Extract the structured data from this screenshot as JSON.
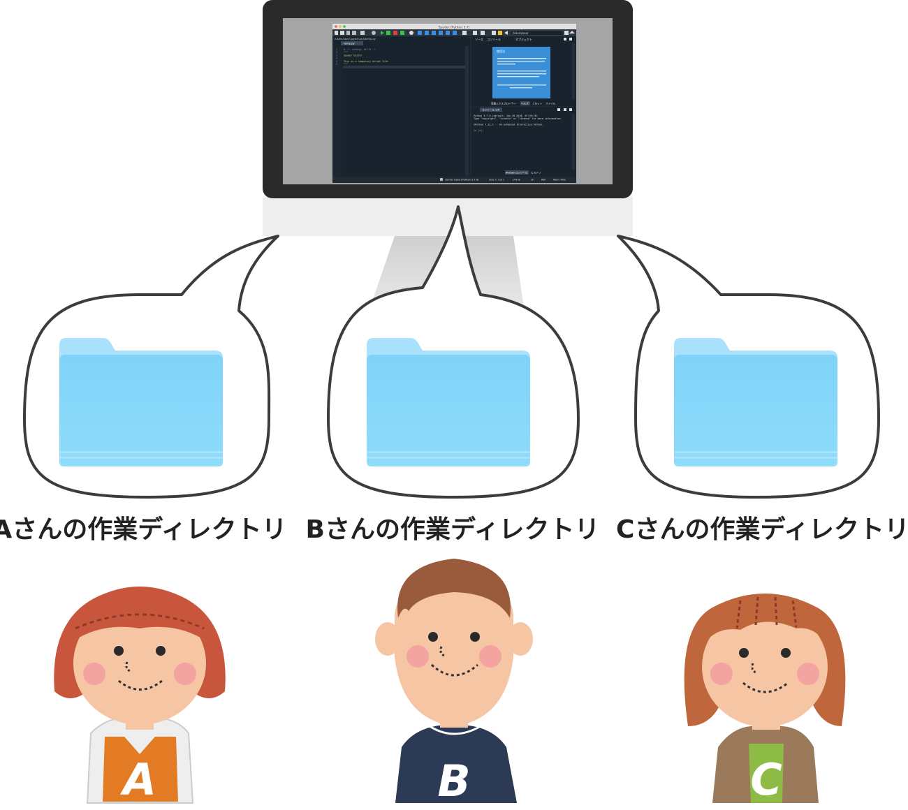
{
  "ide": {
    "window_title": "Spyder (Python 3.7)",
    "path_field": "/Users/user",
    "editor_tab": "temp.py",
    "editor_path": "/Users/user/.spyder-py3/temp.py",
    "code_lines": [
      "# -*- coding: utf-8 -*-",
      "\"\"\"",
      "Spyder Editor",
      "",
      "This is a temporary script file.",
      "\"\"\""
    ],
    "help_panel": {
      "tabs": [
        "ソース",
        "コンソール",
        "オブジェクト"
      ],
      "card_title": "使用法",
      "bottom_tabs": [
        "変数エクスプローラー",
        "ヘルプ",
        "プロット",
        "ファイル"
      ]
    },
    "console": {
      "tab": "コンソール 1/A",
      "lines": [
        "Python 3.7.0 (default, Jun 28 2018, 07:39:16)",
        "Type \"copyright\", \"credits\" or \"license\" for more information.",
        "",
        "IPython 7.12.1 -- An enhanced Interactive Python.",
        "",
        "In [1]:"
      ],
      "bottom_tabs": [
        "IPythonコンソール",
        "ヒストリ"
      ]
    },
    "status_bar": [
      "conda: base (Python 3.7.6)",
      "Line 7, Col 1",
      "UTF-8",
      "LF",
      "RW",
      "Mem 76%"
    ]
  },
  "colors": {
    "folder_light": "#a9e0fb",
    "folder_dark": "#66c6f2",
    "shirt_a": "#e27b23",
    "shirt_b": "#2c3a55",
    "shirt_c": "#9a7a5a",
    "hair_a": "#c8563c",
    "hair_b": "#9a5a3c",
    "hair_c": "#c0663c"
  },
  "users": [
    {
      "caption": "Aさんの作業ディレクトリ",
      "badge": "A"
    },
    {
      "caption": "Bさんの作業ディレクトリ",
      "badge": "B"
    },
    {
      "caption": "Cさんの作業ディレクトリ",
      "badge": "C"
    }
  ]
}
